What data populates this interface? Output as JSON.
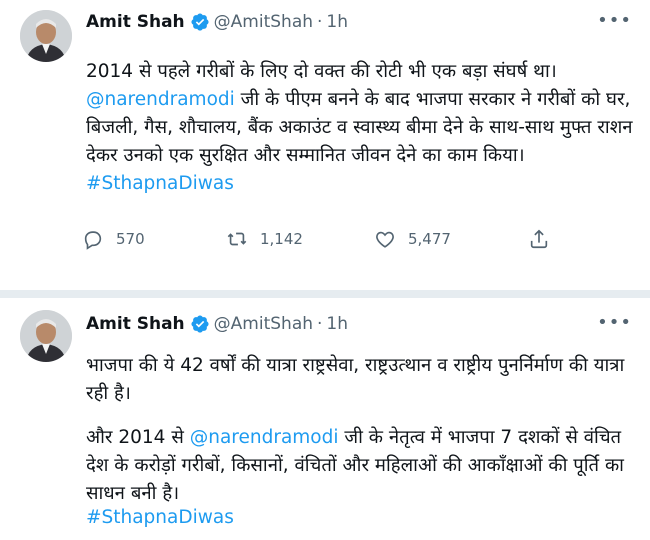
{
  "tweets": [
    {
      "author_name": "Amit Shah",
      "handle": "@AmitShah",
      "separator": "·",
      "time": "1h",
      "text_part1": "2014 से पहले गरीबों के लिए दो वक्त की रोटी भी एक बड़ा संघर्ष था। ",
      "mention": "@narendramodi",
      "text_part2": " जी के पीएम बनने के बाद भाजपा सरकार ने गरीबों को घर, बिजली, गैस, शौचालय, बैंक अकाउंट व स्वास्थ्य बीमा देने के साथ-साथ मुफ्त राशन देकर उनको एक सुरक्षित और सम्मानित जीवन देने का काम किया। ",
      "hashtag": "#SthapnaDiwas",
      "replies": "570",
      "retweets": "1,142",
      "likes": "5,477"
    },
    {
      "author_name": "Amit Shah",
      "handle": "@AmitShah",
      "separator": "·",
      "time": "1h",
      "paragraph1": "भाजपा की ये 42 वर्षों की यात्रा राष्ट्रसेवा, राष्ट्रउत्थान व राष्ट्रीय पुनर्निर्माण की यात्रा रही है।",
      "p2_part1": "और 2014 से ",
      "mention": "@narendramodi",
      "p2_part2": " जी के नेतृत्व में भाजपा 7 दशकों से वंचित देश के करोड़ों गरीबों, किसानों, वंचितों और महिलाओं की आकाँक्षाओं की पूर्ति का साधन बनी है।",
      "hashtag": "#SthapnaDiwas"
    }
  ],
  "colors": {
    "link": "#1d9bf0",
    "verified": "#1d9bf0",
    "secondary_text": "#536471",
    "divider": "#e6ecf0"
  },
  "icons": {
    "verified": "verified-badge-icon",
    "more": "more-options-icon",
    "reply": "reply-icon",
    "retweet": "retweet-icon",
    "like": "heart-icon",
    "share": "share-icon"
  }
}
